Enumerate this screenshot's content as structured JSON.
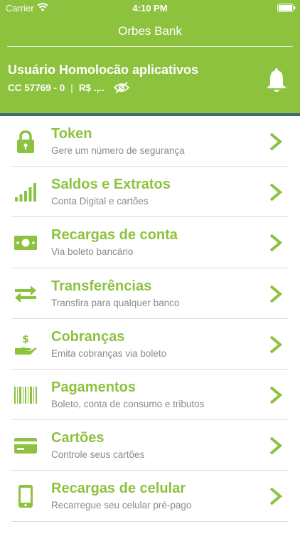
{
  "status_bar": {
    "carrier": "Carrier",
    "time": "4:10 PM"
  },
  "header": {
    "title": "Orbes Bank",
    "user_name": "Usuário Homolocão aplicativos",
    "account": "CC 57769 - 0",
    "separator": "|",
    "balance": "R$ .,.."
  },
  "colors": {
    "brand_green": "#8dc23f",
    "accent_line": "#3d6b7a",
    "subtitle_gray": "#8a8a8a"
  },
  "menu": {
    "items": [
      {
        "title": "Token",
        "subtitle": "Gere um número de segurança",
        "icon": "lock-icon"
      },
      {
        "title": "Saldos e Extratos",
        "subtitle": "Conta Digital e cartões",
        "icon": "signal-bars-icon"
      },
      {
        "title": "Recargas de conta",
        "subtitle": "Via boleto bancário",
        "icon": "banknote-icon"
      },
      {
        "title": "Transferências",
        "subtitle": "Transfira para qualquer banco",
        "icon": "transfer-arrows-icon"
      },
      {
        "title": "Cobranças",
        "subtitle": "Emita cobranças via boleto",
        "icon": "hand-money-icon"
      },
      {
        "title": "Pagamentos",
        "subtitle": "Boleto, conta de consumo e tributos",
        "icon": "barcode-icon"
      },
      {
        "title": "Cartões",
        "subtitle": "Controle seus cartões",
        "icon": "credit-card-icon"
      },
      {
        "title": "Recargas de celular",
        "subtitle": "Recarregue seu celular pré-pago",
        "icon": "mobile-phone-icon"
      }
    ]
  }
}
